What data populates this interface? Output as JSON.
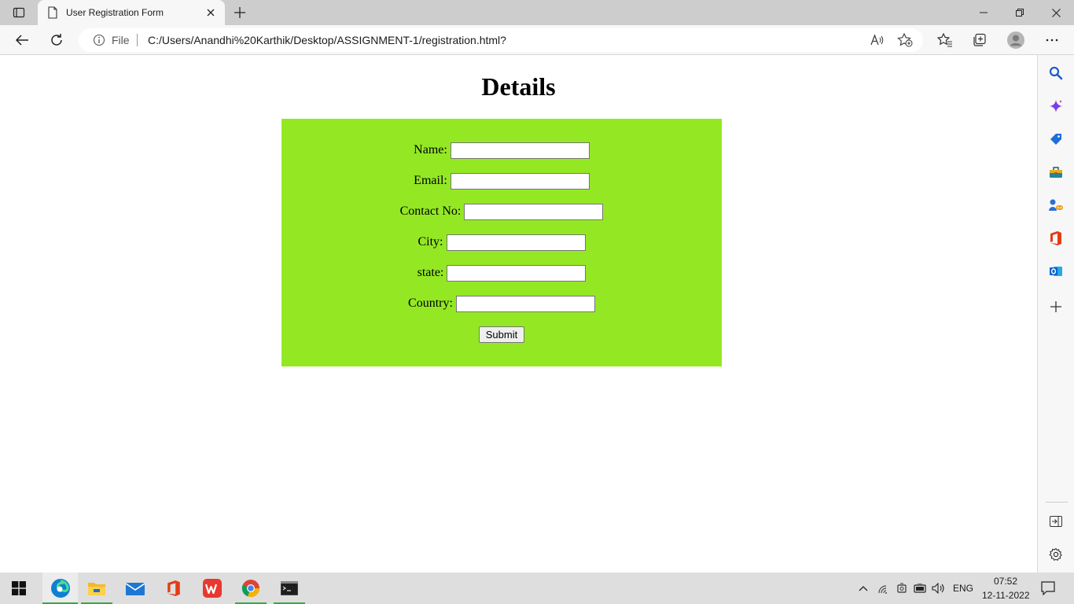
{
  "browser": {
    "tab_title": "User Registration Form",
    "address": {
      "scheme_label": "File",
      "url": "C:/Users/Anandhi%20Karthik/Desktop/ASSIGNMENT-1/registration.html?"
    }
  },
  "page": {
    "heading": "Details",
    "form": {
      "background_color": "#94e823",
      "fields": [
        {
          "label": "Name:",
          "value": ""
        },
        {
          "label": "Email:",
          "value": ""
        },
        {
          "label": "Contact No:",
          "value": ""
        },
        {
          "label": "City:",
          "value": ""
        },
        {
          "label": "state:",
          "value": ""
        },
        {
          "label": "Country:",
          "value": ""
        }
      ],
      "submit_label": "Submit"
    }
  },
  "taskbar": {
    "language": "ENG",
    "time": "07:52",
    "date": "12-11-2022"
  }
}
